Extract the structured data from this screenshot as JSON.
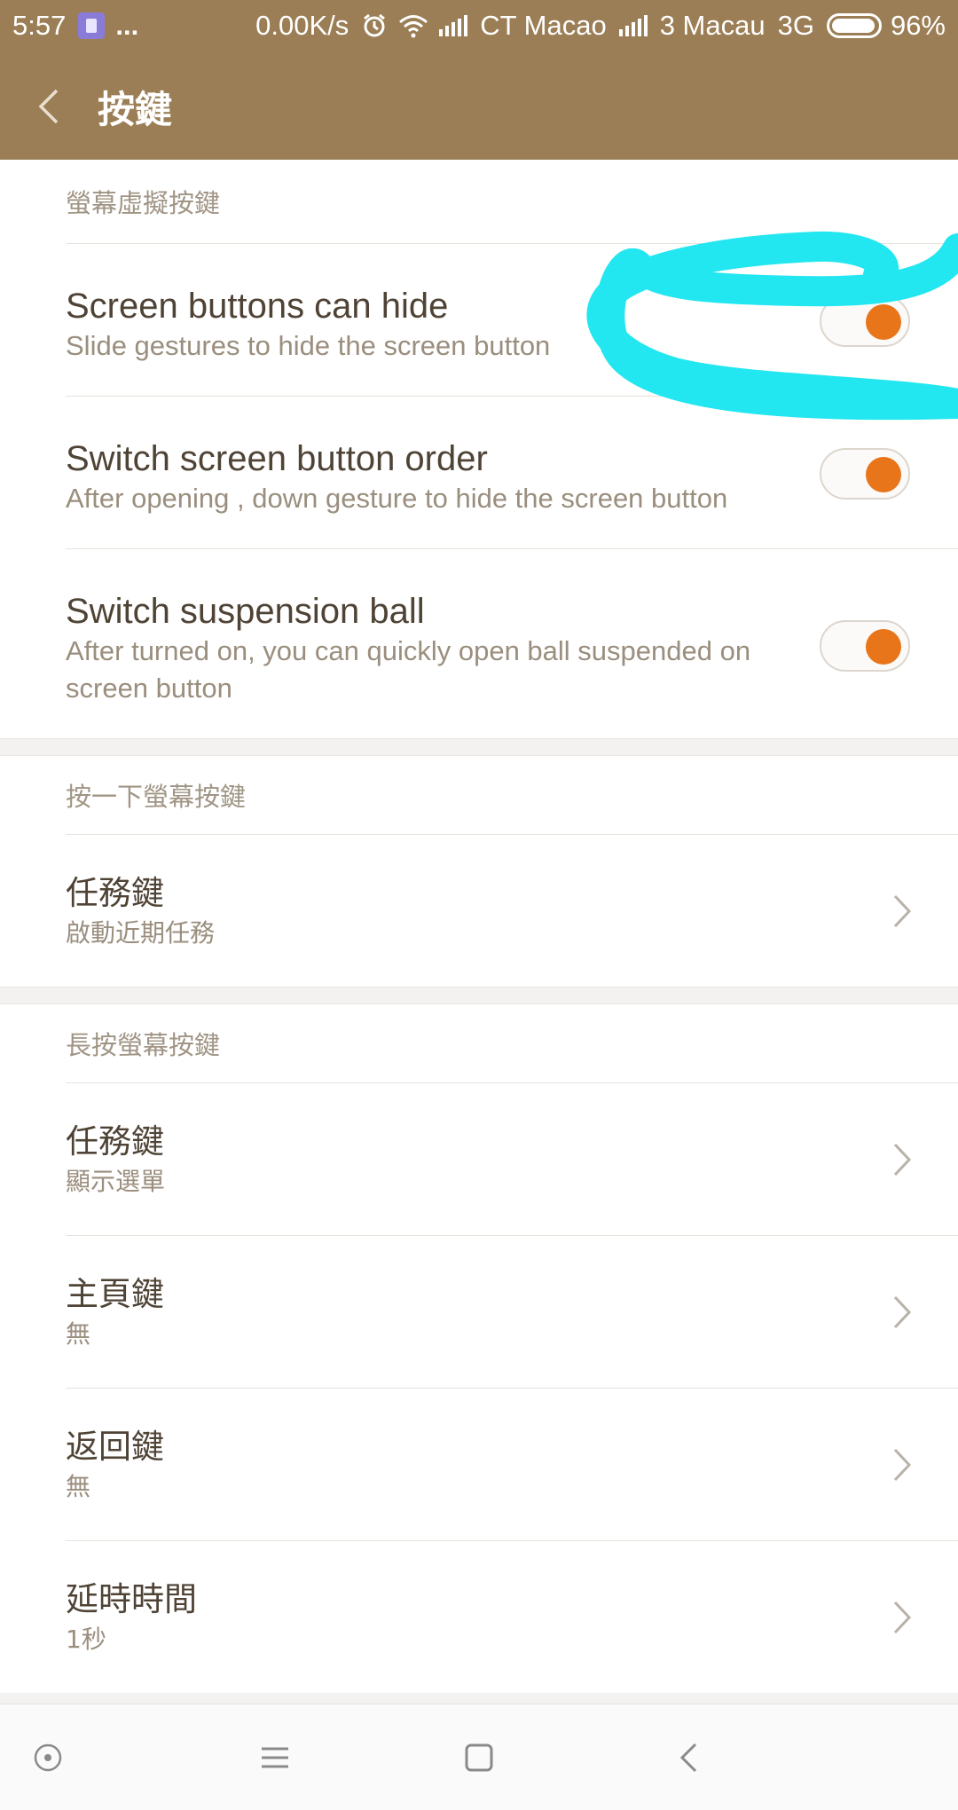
{
  "status_bar": {
    "time": "5:57",
    "more": "...",
    "net_speed": "0.00K/s",
    "carrier1": "CT Macao",
    "carrier2": "3 Macau",
    "network_type": "3G",
    "battery": "96%",
    "icons": [
      "app-notification-icon",
      "alarm-icon",
      "wifi-icon",
      "signal-icon",
      "battery-icon"
    ]
  },
  "header": {
    "title": "按鍵",
    "back_icon": "chevron-left-icon"
  },
  "sections": [
    {
      "header": "螢幕虛擬按鍵",
      "items": [
        {
          "title": "Screen buttons can hide",
          "subtitle": "Slide gestures to hide the screen button",
          "control": "toggle",
          "on": true
        },
        {
          "title": "Switch screen button order",
          "subtitle": "After opening , down gesture to hide the screen button",
          "control": "toggle",
          "on": true
        },
        {
          "title": "Switch suspension ball",
          "subtitle": "After turned on, you can quickly open ball suspended on screen button",
          "control": "toggle",
          "on": true
        }
      ]
    },
    {
      "header": "按一下螢幕按鍵",
      "items": [
        {
          "title": "任務鍵",
          "subtitle": "啟動近期任務",
          "control": "chevron"
        }
      ]
    },
    {
      "header": "長按螢幕按鍵",
      "items": [
        {
          "title": "任務鍵",
          "subtitle": "顯示選單",
          "control": "chevron"
        },
        {
          "title": "主頁鍵",
          "subtitle": "無",
          "control": "chevron"
        },
        {
          "title": "返回鍵",
          "subtitle": "無",
          "control": "chevron"
        },
        {
          "title": "延時時間",
          "subtitle": "1秒",
          "control": "chevron"
        }
      ]
    }
  ],
  "colors": {
    "header_bg": "#9b7e55",
    "toggle_on": "#e8751a",
    "annotation": "#22e6f0"
  },
  "nav_bar": {
    "icons": [
      "assistant-circle-icon",
      "menu-icon",
      "home-square-icon",
      "back-icon"
    ]
  }
}
